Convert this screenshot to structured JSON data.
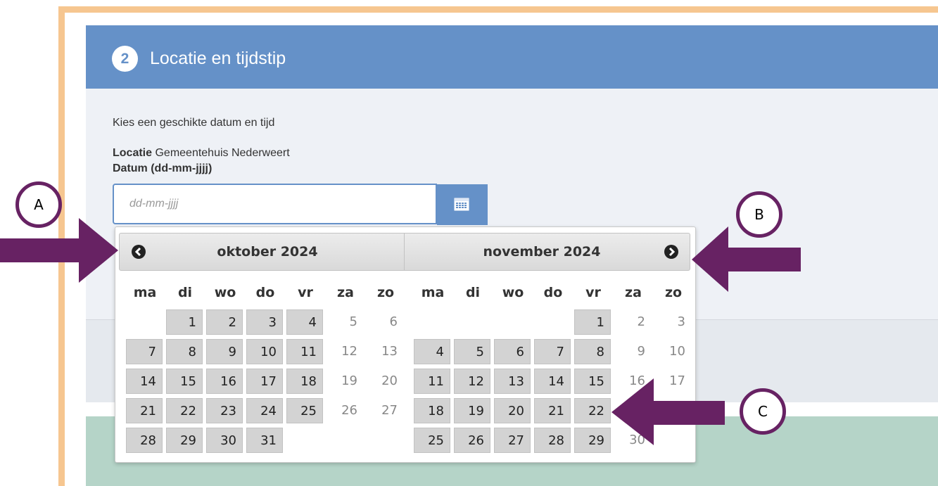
{
  "step": {
    "number": "2",
    "title": "Locatie en tijdstip"
  },
  "instruction": "Kies een geschikte datum en tijd",
  "location": {
    "label": "Locatie",
    "value": "Gemeentehuis Nederweert"
  },
  "date_field": {
    "label": "Datum (dd-mm-jjjj)",
    "placeholder": "dd-mm-jjjj"
  },
  "calendar": {
    "weekdays": [
      "ma",
      "di",
      "wo",
      "do",
      "vr",
      "za",
      "zo"
    ],
    "months": [
      {
        "title": "oktober 2024",
        "weeks": [
          [
            null,
            {
              "d": "1",
              "a": true
            },
            {
              "d": "2",
              "a": true
            },
            {
              "d": "3",
              "a": true
            },
            {
              "d": "4",
              "a": true
            },
            {
              "d": "5",
              "a": false
            },
            {
              "d": "6",
              "a": false
            }
          ],
          [
            {
              "d": "7",
              "a": true
            },
            {
              "d": "8",
              "a": true
            },
            {
              "d": "9",
              "a": true
            },
            {
              "d": "10",
              "a": true
            },
            {
              "d": "11",
              "a": true
            },
            {
              "d": "12",
              "a": false
            },
            {
              "d": "13",
              "a": false
            }
          ],
          [
            {
              "d": "14",
              "a": true
            },
            {
              "d": "15",
              "a": true
            },
            {
              "d": "16",
              "a": true
            },
            {
              "d": "17",
              "a": true
            },
            {
              "d": "18",
              "a": true
            },
            {
              "d": "19",
              "a": false
            },
            {
              "d": "20",
              "a": false
            }
          ],
          [
            {
              "d": "21",
              "a": true
            },
            {
              "d": "22",
              "a": true
            },
            {
              "d": "23",
              "a": true
            },
            {
              "d": "24",
              "a": true
            },
            {
              "d": "25",
              "a": true
            },
            {
              "d": "26",
              "a": false
            },
            {
              "d": "27",
              "a": false
            }
          ],
          [
            {
              "d": "28",
              "a": true
            },
            {
              "d": "29",
              "a": true
            },
            {
              "d": "30",
              "a": true
            },
            {
              "d": "31",
              "a": true
            },
            null,
            null,
            null
          ]
        ]
      },
      {
        "title": "november 2024",
        "weeks": [
          [
            null,
            null,
            null,
            null,
            {
              "d": "1",
              "a": true
            },
            {
              "d": "2",
              "a": false
            },
            {
              "d": "3",
              "a": false
            }
          ],
          [
            {
              "d": "4",
              "a": true
            },
            {
              "d": "5",
              "a": true
            },
            {
              "d": "6",
              "a": true
            },
            {
              "d": "7",
              "a": true
            },
            {
              "d": "8",
              "a": true
            },
            {
              "d": "9",
              "a": false
            },
            {
              "d": "10",
              "a": false
            }
          ],
          [
            {
              "d": "11",
              "a": true
            },
            {
              "d": "12",
              "a": true
            },
            {
              "d": "13",
              "a": true
            },
            {
              "d": "14",
              "a": true
            },
            {
              "d": "15",
              "a": true
            },
            {
              "d": "16",
              "a": false
            },
            {
              "d": "17",
              "a": false
            }
          ],
          [
            {
              "d": "18",
              "a": true
            },
            {
              "d": "19",
              "a": true
            },
            {
              "d": "20",
              "a": true
            },
            {
              "d": "21",
              "a": true
            },
            {
              "d": "22",
              "a": true
            },
            null,
            null
          ],
          [
            {
              "d": "25",
              "a": true
            },
            {
              "d": "26",
              "a": true
            },
            {
              "d": "27",
              "a": true
            },
            {
              "d": "28",
              "a": true
            },
            {
              "d": "29",
              "a": true
            },
            {
              "d": "30",
              "a": false
            },
            null
          ]
        ]
      }
    ]
  },
  "annotations": {
    "a": "A",
    "b": "B",
    "c": "C"
  },
  "colors": {
    "header": "#6591c8",
    "frame": "#f6c690",
    "annotation": "#672263",
    "available_day": "#d3d3d3"
  },
  "icons": {
    "prev": "chevron-left-circle-icon",
    "next": "chevron-right-circle-icon",
    "calendar": "calendar-icon"
  }
}
